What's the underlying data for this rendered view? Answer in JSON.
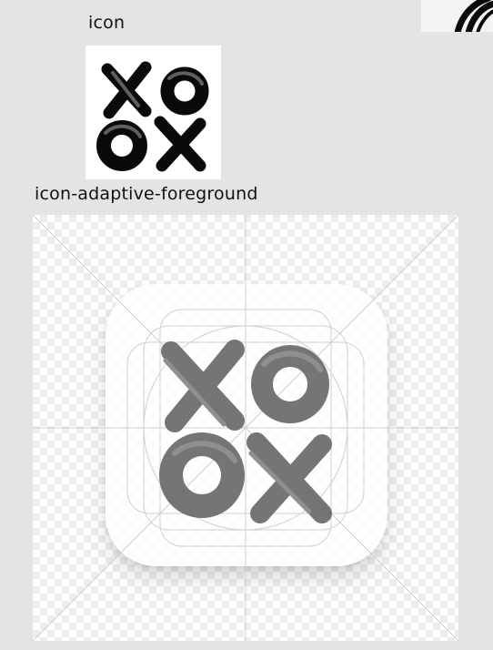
{
  "labels": {
    "icon": "icon",
    "adaptive_foreground": "icon-adaptive-foreground"
  },
  "assets": {
    "icon_image": "xoox-brush-logo",
    "foreground_image": "xoox-brush-logo-foreground",
    "corner_thumbnail": "partial-brush-stroke"
  },
  "colors": {
    "page_background": "#e4e4e4",
    "logo_dark": "#0a0a0a",
    "logo_foreground_gray": "#6e6e6e",
    "checker_light": "#ffffff",
    "checker_dark": "#ececec"
  }
}
